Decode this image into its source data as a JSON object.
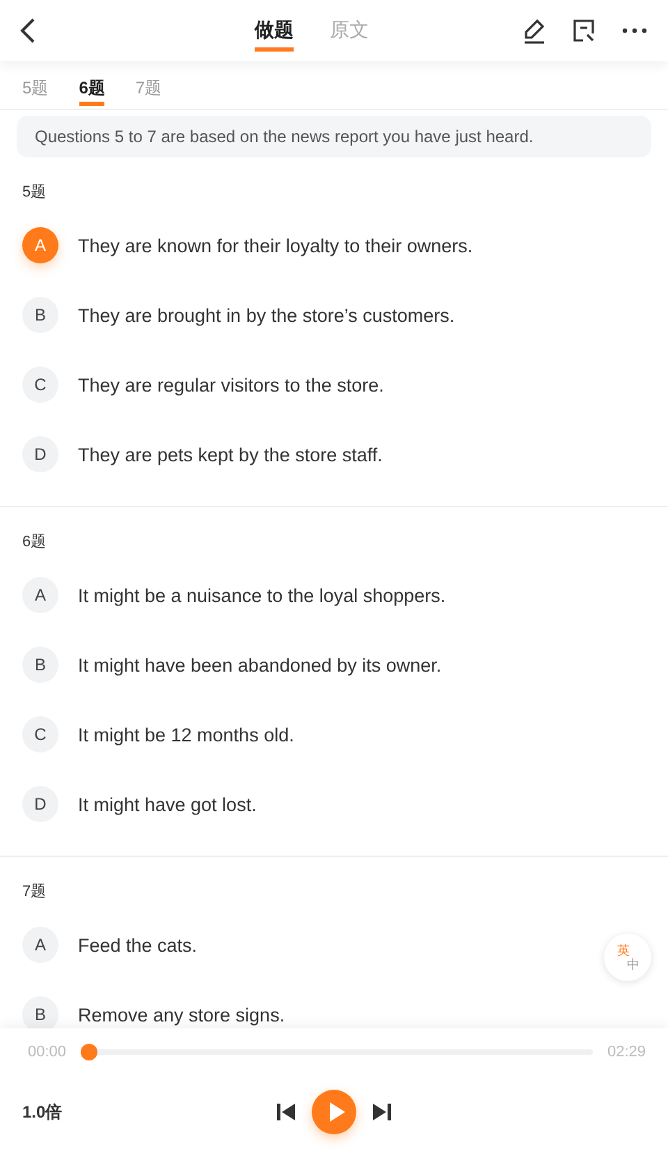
{
  "header": {
    "tabs": [
      {
        "label": "做题",
        "selected": true
      },
      {
        "label": "原文",
        "selected": false
      }
    ]
  },
  "question_tabs": [
    {
      "label": "5题",
      "selected": false
    },
    {
      "label": "6题",
      "selected": true
    },
    {
      "label": "7题",
      "selected": false
    }
  ],
  "instruction": "Questions 5 to 7 are based on the news report you have just heard.",
  "questions": [
    {
      "title": "5题",
      "options": [
        {
          "letter": "A",
          "text": "They are known for their loyalty to their owners.",
          "selected": true
        },
        {
          "letter": "B",
          "text": "They are brought in by the store’s customers.",
          "selected": false
        },
        {
          "letter": "C",
          "text": "They are regular visitors to the store.",
          "selected": false
        },
        {
          "letter": "D",
          "text": "They are pets kept by the store staff.",
          "selected": false
        }
      ]
    },
    {
      "title": "6题",
      "options": [
        {
          "letter": "A",
          "text": "It might be a nuisance to the loyal shoppers.",
          "selected": false
        },
        {
          "letter": "B",
          "text": "It might have been abandoned by its owner.",
          "selected": false
        },
        {
          "letter": "C",
          "text": "It might be 12 months old.",
          "selected": false
        },
        {
          "letter": "D",
          "text": "It might have got lost.",
          "selected": false
        }
      ]
    },
    {
      "title": "7题",
      "options": [
        {
          "letter": "A",
          "text": "Feed the cats.",
          "selected": false
        },
        {
          "letter": "B",
          "text": "Remove any store signs.",
          "selected": false
        }
      ]
    }
  ],
  "language_toggle": {
    "primary": "英",
    "secondary": "中"
  },
  "player": {
    "elapsed": "00:00",
    "total": "02:29",
    "level": 0,
    "speed": "1.0倍"
  }
}
